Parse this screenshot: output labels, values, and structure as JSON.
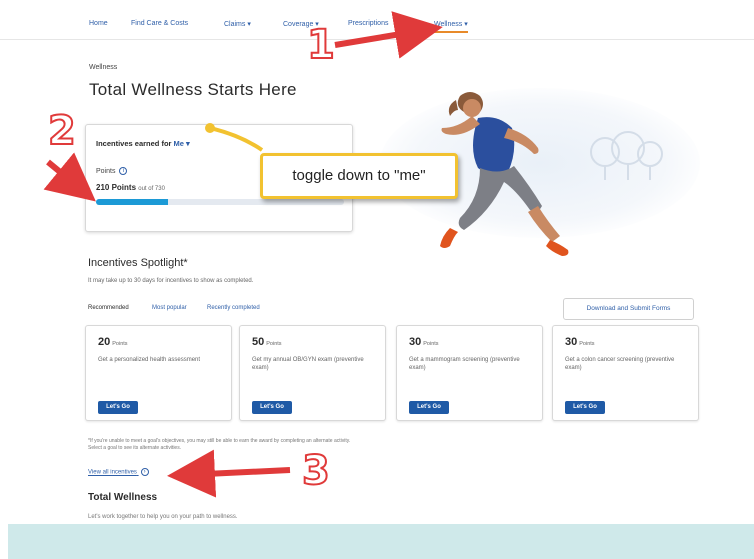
{
  "nav": {
    "items": [
      {
        "label": "Home"
      },
      {
        "label": "Find Care & Costs"
      },
      {
        "label": "Claims ▾"
      },
      {
        "label": "Coverage ▾"
      },
      {
        "label": "Prescriptions"
      },
      {
        "label": "Wellness ▾",
        "active": true
      }
    ]
  },
  "page": {
    "eyebrow": "Wellness",
    "title": "Total Wellness Starts Here"
  },
  "incentives": {
    "heading_prefix": "Incentives earned for",
    "who": "Me ▾",
    "points_label": "Points",
    "points_value": "210 Points",
    "points_sub": "out of 730",
    "progress_fraction": 0.29
  },
  "callout": {
    "text": "toggle down to \"me\""
  },
  "spotlight": {
    "title": "Incentives Spotlight*",
    "note": "It may take up to 30 days for incentives to show as completed.",
    "tabs": [
      "Recommended",
      "Most popular",
      "Recently completed"
    ],
    "download_label": "Download and Submit Forms",
    "cards": [
      {
        "points": "20",
        "unit": "Points",
        "desc": "Get a personalized health assessment",
        "cta": "Let's Go"
      },
      {
        "points": "50",
        "unit": "Points",
        "desc": "Get my annual OB/GYN exam (preventive exam)",
        "cta": "Let's Go"
      },
      {
        "points": "30",
        "unit": "Points",
        "desc": "Get a mammogram screening (preventive exam)",
        "cta": "Let's Go"
      },
      {
        "points": "30",
        "unit": "Points",
        "desc": "Get a colon cancer screening (preventive exam)",
        "cta": "Let's Go"
      }
    ]
  },
  "footnote": {
    "line1": "*If you're unable to meet a goal's objectives, you may still be able to earn the award by completing an alternate activity.",
    "line2": "Select a goal to see its alternate activities.",
    "view_all": "View all incentives"
  },
  "total_wellness": {
    "title": "Total Wellness",
    "sub": "Let's work together to help you on your path to wellness."
  },
  "annotations": {
    "markers": [
      "1",
      "2",
      "3"
    ],
    "arrow_color": "#e03a3a",
    "pointer_color": "#f2c230"
  }
}
